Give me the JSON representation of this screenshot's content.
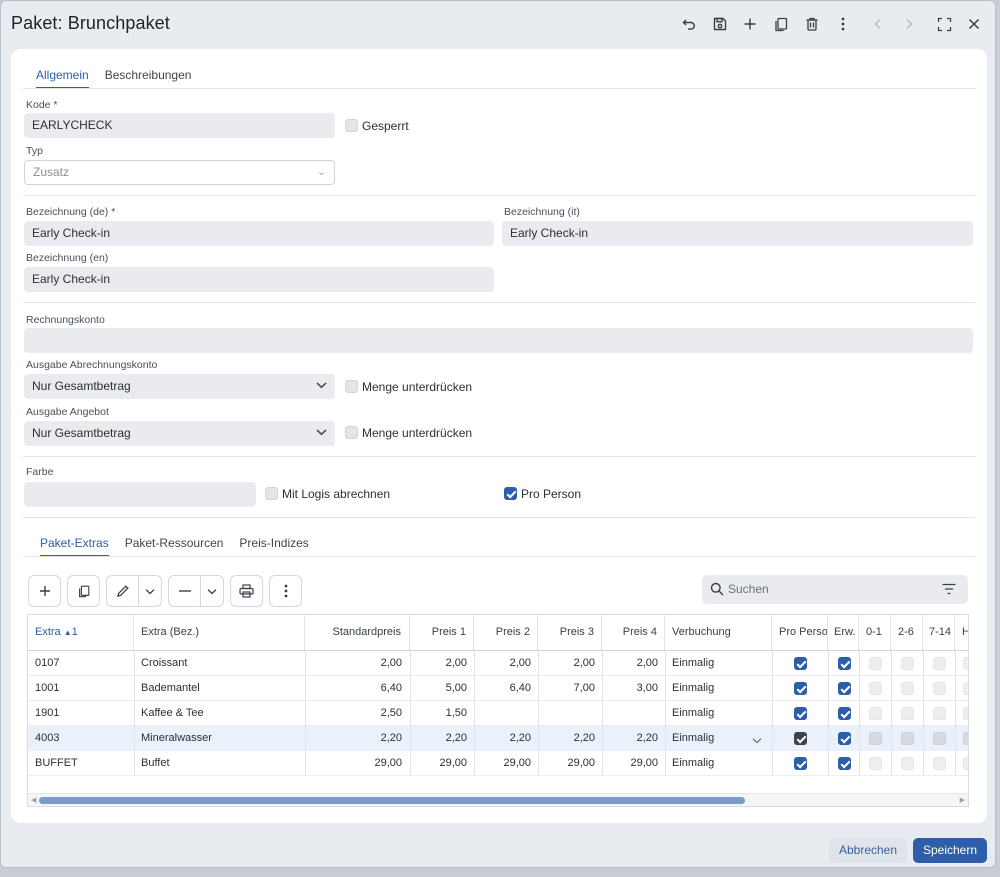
{
  "window": {
    "title": "Paket: Brunchpaket",
    "toolbar_icons": [
      "undo-icon",
      "save-icon",
      "add-icon",
      "copy-icon",
      "delete-icon",
      "more-vertical-icon",
      "chevron-left-icon",
      "chevron-right-icon",
      "maximize-icon",
      "close-icon"
    ]
  },
  "tabs": [
    {
      "label": "Allgemein",
      "active": true
    },
    {
      "label": "Beschreibungen",
      "active": false
    }
  ],
  "form": {
    "kode": {
      "label": "Kode *",
      "value": "EARLYCHECK"
    },
    "gesperrt": {
      "label": "Gesperrt",
      "checked": false
    },
    "typ": {
      "label": "Typ",
      "value": "Zusatz"
    },
    "bez_de": {
      "label": "Bezeichnung (de) *",
      "value": "Early Check-in"
    },
    "bez_it": {
      "label": "Bezeichnung (it)",
      "value": "Early Check-in"
    },
    "bez_en": {
      "label": "Bezeichnung (en)",
      "value": "Early Check-in"
    },
    "rechnungskonto": {
      "label": "Rechnungskonto",
      "value": ""
    },
    "ausgabe_abrechnung": {
      "label": "Ausgabe Abrechnungskonto",
      "value": "Nur Gesamtbetrag"
    },
    "menge1": {
      "label": "Menge unterdrücken",
      "checked": false
    },
    "ausgabe_angebot": {
      "label": "Ausgabe Angebot",
      "value": "Nur Gesamtbetrag"
    },
    "menge2": {
      "label": "Menge unterdrücken",
      "checked": false
    },
    "farbe": {
      "label": "Farbe",
      "value": ""
    },
    "mit_logis": {
      "label": "Mit Logis abrechnen",
      "checked": false
    },
    "pro_person": {
      "label": "Pro Person",
      "checked": true
    }
  },
  "subtabs": [
    {
      "label": "Paket-Extras",
      "active": true
    },
    {
      "label": "Paket-Ressourcen",
      "active": false
    },
    {
      "label": "Preis-Indizes",
      "active": false
    }
  ],
  "search": {
    "placeholder": "Suchen"
  },
  "table": {
    "headers": [
      "Extra",
      "Extra (Bez.)",
      "Standardpreis",
      "Preis 1",
      "Preis 2",
      "Preis 3",
      "Preis 4",
      "Verbuchung",
      "Pro Person",
      "Erw.",
      "0-1",
      "2-6",
      "7-14",
      "H"
    ],
    "sort_indicator": "1",
    "rows": [
      {
        "extra": "0107",
        "bez": "Croissant",
        "std": "2,00",
        "p1": "2,00",
        "p2": "2,00",
        "p3": "2,00",
        "p4": "2,00",
        "verb": "Einmalig",
        "pp": true,
        "erw": true
      },
      {
        "extra": "1001",
        "bez": "Bademantel",
        "std": "6,40",
        "p1": "5,00",
        "p2": "6,40",
        "p3": "7,00",
        "p4": "3,00",
        "verb": "Einmalig",
        "pp": true,
        "erw": true
      },
      {
        "extra": "1901",
        "bez": "Kaffee & Tee",
        "std": "2,50",
        "p1": "1,50",
        "p2": "",
        "p3": "",
        "p4": "",
        "verb": "Einmalig",
        "pp": true,
        "erw": true
      },
      {
        "extra": "4003",
        "bez": "Mineralwasser",
        "std": "2,20",
        "p1": "2,20",
        "p2": "2,20",
        "p3": "2,20",
        "p4": "2,20",
        "verb": "Einmalig",
        "pp": true,
        "erw": true,
        "selected": true
      },
      {
        "extra": "BUFFET",
        "bez": "Buffet",
        "std": "29,00",
        "p1": "29,00",
        "p2": "29,00",
        "p3": "29,00",
        "p4": "29,00",
        "verb": "Einmalig",
        "pp": true,
        "erw": true
      }
    ]
  },
  "footer": {
    "cancel": "Abbrechen",
    "save": "Speichern"
  },
  "colors": {
    "accent": "#2c5fa8",
    "selected_row": "#eaf1fb"
  }
}
